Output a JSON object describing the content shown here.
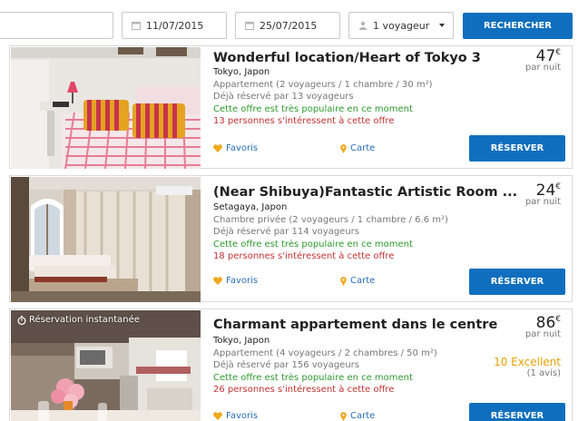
{
  "search": {
    "destination": "",
    "checkin": "11/07/2015",
    "checkout": "25/07/2015",
    "guests": "1 voyageur",
    "button": "RECHERCHER"
  },
  "listings": [
    {
      "title": "Wonderful location/Heart of Tokyo 3",
      "city": "Tokyo, Japon",
      "detail": "Appartement (2 voyageurs / 1 chambre / 30 m²)",
      "booked": "Déjà réservé par 13 voyageurs",
      "popular": "Cette offre est très populaire en ce moment",
      "interest": "13 personnes s'intéressent à cette offre",
      "price": "47",
      "currency": "€",
      "per_night": "par nuit",
      "favorite": "Favoris",
      "map": "Carte",
      "book": "RÉSERVER"
    },
    {
      "title": "(Near Shibuya)Fantastic Artistic Room ...",
      "city": "Setagaya, Japon",
      "detail": "Chambre privée (2 voyageurs / 1 chambre / 6.6 m²)",
      "booked": "Déjà réservé par 114 voyageurs",
      "popular": "Cette offre est très populaire en ce moment",
      "interest": "18 personnes s'intéressent à cette offre",
      "price": "24",
      "currency": "€",
      "per_night": "par nuit",
      "favorite": "Favoris",
      "map": "Carte",
      "book": "RÉSERVER"
    },
    {
      "badge": "Réservation instantanée",
      "title": "Charmant appartement dans le centre",
      "city": "Tokyo, Japon",
      "detail": "Appartement (4 voyageurs / 2 chambres / 50 m²)",
      "booked": "Déjà réservé par 156 voyageurs",
      "popular": "Cette offre est très populaire en ce moment",
      "interest": "26 personnes s'intéressent à cette offre",
      "price": "86",
      "currency": "€",
      "per_night": "par nuit",
      "rating": "10 Excellent",
      "reviews": "(1 avis)",
      "favorite": "Favoris",
      "map": "Carte",
      "book": "RÉSERVER"
    }
  ],
  "colors": {
    "primary": "#0f6fbe",
    "popular": "#2f9a2f",
    "interest": "#c43232",
    "rating": "#e6a000",
    "favorite_icon": "#f0a81c"
  },
  "icons": {
    "checkin": "calendar-icon",
    "checkout": "calendar-icon",
    "guests": "person-icon",
    "favorite": "heart-icon",
    "map": "map-pin-icon",
    "badge": "stopwatch-icon"
  }
}
